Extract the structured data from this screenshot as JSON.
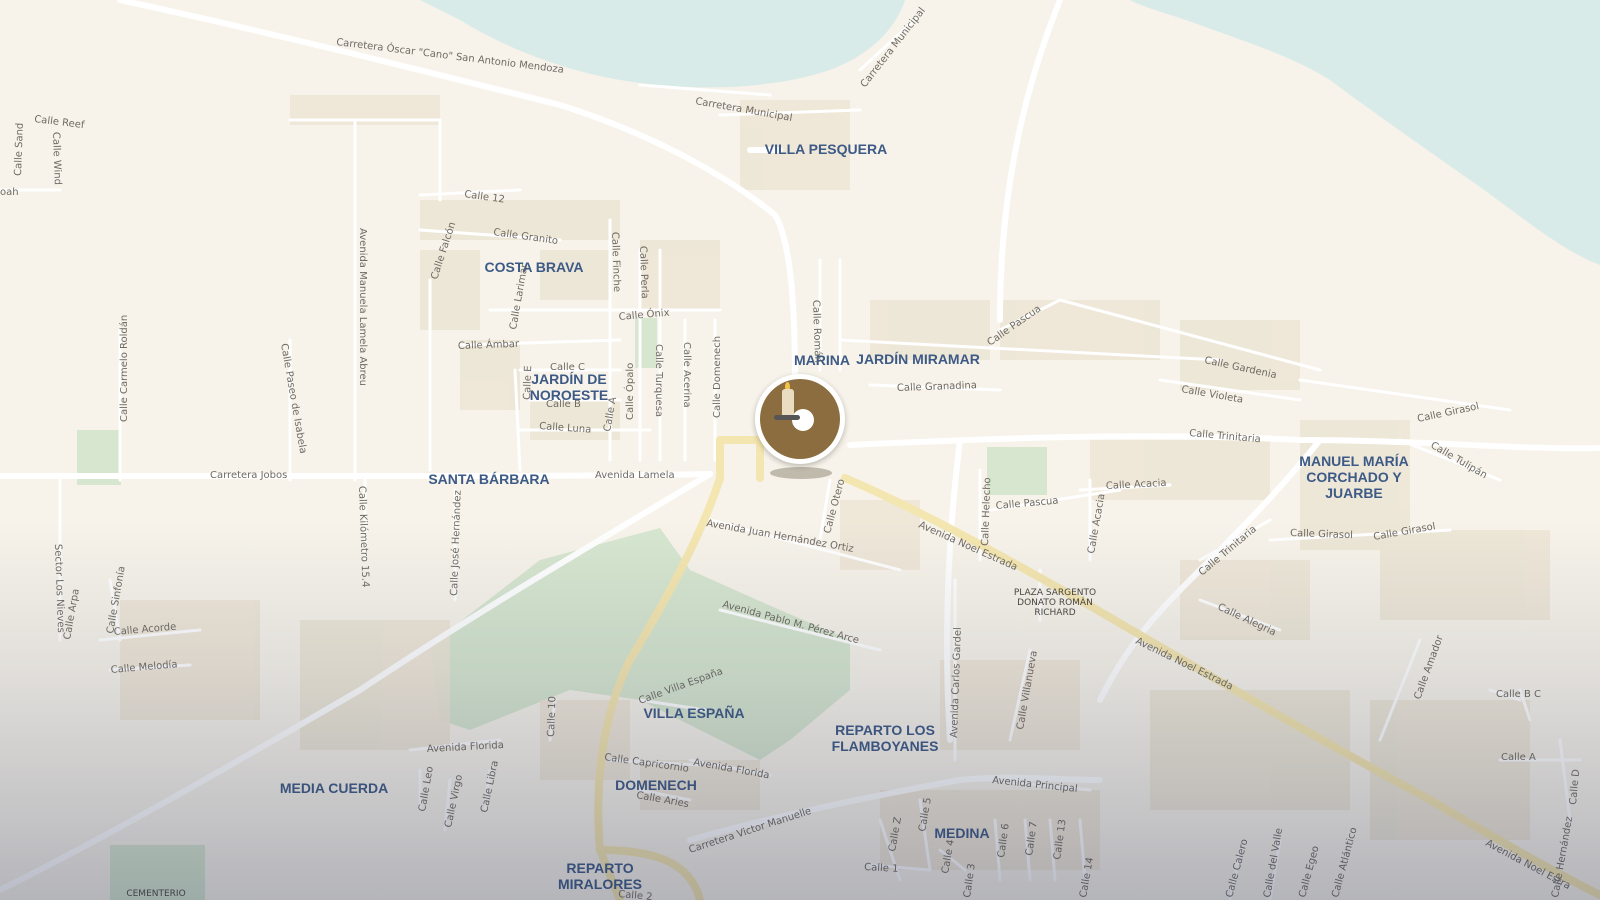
{
  "map": {
    "colors": {
      "land": "#f7f3ea",
      "water": "#d9ebe9",
      "park": "#d6e6cf",
      "major_road": "#f4e6b0",
      "label": "#3d5a86"
    },
    "neighborhoods": {
      "villa_pesquera": "VILLA PESQUERA",
      "costa_brava": "COSTA BRAVA",
      "marina": "MARINA",
      "jardin_miramar": "JARDÍN MIRAMAR",
      "jardin_noroeste_1": "JARDÍN DE",
      "jardin_noroeste_2": "NOROESTE",
      "santa_barbara": "SANTA BÁRBARA",
      "manuel_1": "MANUEL MARÍA",
      "manuel_2": "CORCHADO Y",
      "manuel_3": "JUARBE",
      "villa_espana": "VILLA ESPAÑA",
      "flamboyanes_1": "REPARTO LOS",
      "flamboyanes_2": "FLAMBOYANES",
      "media_cuerda": "MEDIA CUERDA",
      "domenech": "DOMENECH",
      "medina": "MEDINA",
      "miralores_1": "REPARTO",
      "miralores_2": "MIRALORES"
    },
    "places": {
      "plaza_1": "PLAZA SARGENTO",
      "plaza_2": "DONATO ROMÁN",
      "plaza_3": "RICHARD",
      "cementerio": "CEMENTERIO"
    },
    "streets": {
      "carretera_oscar": "Carretera Óscar \"Cano\" San Antonio Mendoza",
      "carretera_municipal_1": "Carretera Municipal",
      "carretera_municipal_2": "Carretera Municipal",
      "calle_reef": "Calle Reef",
      "calle_sand": "Calle Sand",
      "calle_wind": "Calle Wind",
      "oah": "oah",
      "calle_12": "Calle 12",
      "calle_granito": "Calle Granito",
      "calle_falcon": "Calle Falcón",
      "calle_finche": "Calle Finche",
      "calle_perla": "Calle Perla",
      "calle_larimar": "Calle Larimar",
      "calle_onix": "Calle Ónix",
      "calle_ambar": "Calle Ámbar",
      "calle_c": "Calle C",
      "calle_e": "Calle E",
      "calle_b": "Calle B",
      "calle_a": "Calle A",
      "calle_opalo": "Calle Ópalo",
      "calle_turquesa": "Calle Turquesa",
      "calle_acerina": "Calle Acerina",
      "calle_domenech": "Calle Domenech",
      "calle_roman": "Calle Román",
      "calle_luna": "Calle Luna",
      "av_manuela": "Avenida Manuela Lamela Abreu",
      "calle_carmelo": "Calle Carmelo Roldán",
      "calle_paseo": "Calle Paseo de Isabela",
      "carretera_jobos": "Carretera Jobos",
      "avenida_lamela": "Avenida Lamela",
      "calle_km": "Calle Kilómetro 15.4",
      "calle_jose": "Calle José Hernández",
      "calle_pascua_1": "Calle Pascua",
      "calle_gardenia": "Calle Gardenia",
      "calle_granadina": "Calle Granadina",
      "calle_violeta": "Calle Violeta",
      "calle_girasol_1": "Calle Girasol",
      "calle_tulipan": "Calle Tulipán",
      "calle_trinitaria_1": "Calle Trinitaria",
      "calle_acacia_1": "Calle Acacia",
      "calle_acacia_2": "Calle Acacia",
      "calle_pascua_2": "Calle Pascua",
      "calle_helecho": "Calle Helecho",
      "calle_otero": "Calle Otero",
      "av_juan": "Avenida Juan Hernández Ortiz",
      "av_noel_1": "Avenida Noel Estrada",
      "av_noel_2": "Avenida Noel Estrada",
      "av_noel_3": "Avenida Noel Estra",
      "calle_girasol_2": "Calle Girasol",
      "calle_girasol_3": "Calle Girasol",
      "calle_trinitaria_2": "Calle Trinitaria",
      "calle_alegria": "Calle Alegria",
      "calle_amador": "Calle Amador",
      "calle_b_c": "Calle B C",
      "calle_a2": "Calle A",
      "calle_d": "Calle D",
      "av_pablo": "Avenida Pablo M. Pérez Arce",
      "av_carlos": "Avenida Carlos Gardel",
      "calle_villanueva": "Calle Villanueva",
      "sector_los_nieves": "Sector Los Nieves",
      "calle_arpa": "Calle Arpa",
      "calle_sinfonia": "Calle Sinfonía",
      "calle_acorde": "Calle Acorde",
      "calle_melodia": "Calle Melodía",
      "calle_villa_espana": "Calle Villa España",
      "calle_10": "Calle 10",
      "avenida_florida_1": "Avenida Florida",
      "avenida_florida_2": "Avenida Florida",
      "calle_leo": "Calle Leo",
      "calle_virgo": "Calle Virgo",
      "calle_libra": "Calle Libra",
      "calle_capricornio": "Calle Capricornio",
      "calle_aries": "Calle Aries",
      "carretera_victor": "Carretera Victor Manuelle",
      "avenida_principal": "Avenida Principal",
      "calle_z": "Calle Z",
      "calle_5": "Calle 5",
      "calle_4": "Calle 4",
      "calle_6": "Calle 6",
      "calle_7": "Calle 7",
      "calle_13": "Calle 13",
      "calle_14": "Calle 14",
      "calle_1": "Calle 1",
      "calle_2": "Calle 2",
      "calle_3": "Calle 3",
      "calle_calero": "Calle Calero",
      "calle_del_valle": "Calle del Valle",
      "calle_egeo": "Calle Egeo",
      "calle_atlantico": "Calle Atlántico",
      "calle_hernandez": "Calle Hernández"
    },
    "marker": {
      "icon": "memorial-candle-icon"
    }
  }
}
